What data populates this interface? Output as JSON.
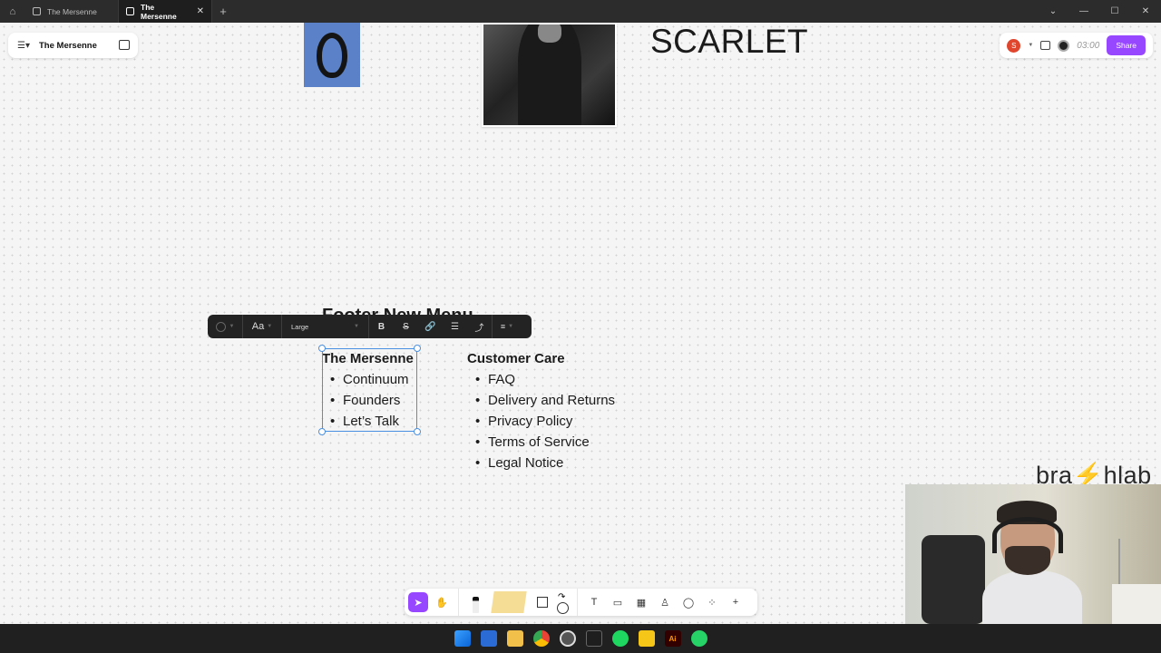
{
  "titlebar": {
    "home_icon": "home-icon",
    "tabs": [
      {
        "label": "The Mersenne",
        "active": false
      },
      {
        "label": "The Mersenne",
        "active": true
      }
    ],
    "add_tab": "+",
    "window_controls": [
      "⌄",
      "—",
      "☐",
      "✕"
    ]
  },
  "file": {
    "name": "The Mersenne"
  },
  "canvas": {
    "heading": "SCARLET",
    "hidden_title": "Footer New Menu",
    "column_a": {
      "title": "The Mersenne",
      "items": [
        "Continuum",
        "Founders",
        "Let’s Talk"
      ]
    },
    "column_b": {
      "title": "Customer Care",
      "items": [
        "FAQ",
        "Delivery and Returns",
        "Privacy Policy",
        "Terms of Service",
        "Legal Notice"
      ]
    },
    "logo": "bra⚡hlab"
  },
  "header_right": {
    "avatar_initial": "S",
    "timer": "03:00",
    "share_label": "Share",
    "accent_color": "#9747ff"
  },
  "format_toolbar": {
    "font_label": "Aa",
    "size_label": "Large",
    "bold": "B",
    "strike": "S"
  },
  "taskbar": {
    "icons": [
      "windows-icon",
      "edge-icon",
      "file-explorer-icon",
      "chrome-icon",
      "chrome-canary-icon",
      "figma-icon",
      "spotify-icon",
      "sticky-notes-icon",
      "illustrator-icon",
      "whatsapp-icon"
    ],
    "ai_label": "Ai"
  }
}
